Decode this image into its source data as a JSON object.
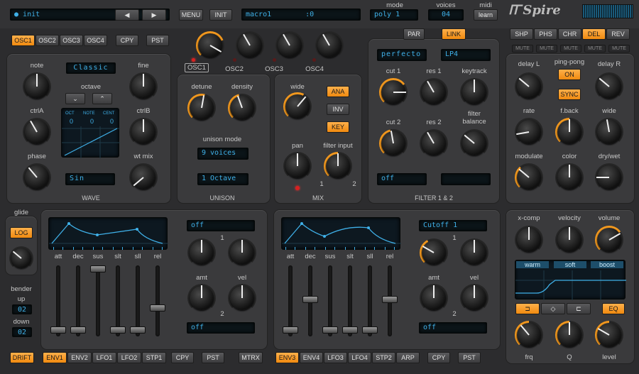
{
  "header": {
    "preset_name": "init",
    "menu": "MENU",
    "init": "INIT",
    "macro": "macro1",
    "macro_val": ":0",
    "mode_label": "mode",
    "mode_val": "poly 1",
    "voices_label": "voices",
    "voices_val": "04",
    "midi_label": "midi",
    "learn": "learn",
    "logo": "Spire"
  },
  "osc_tabs": [
    "OSC1",
    "OSC2",
    "OSC3",
    "OSC4"
  ],
  "cpy": "CPY",
  "pst": "PST",
  "osc_knobs": [
    "OSC1",
    "OSC2",
    "OSC3",
    "OSC4"
  ],
  "osc": {
    "note": "note",
    "fine": "fine",
    "mode": "Classic",
    "octave": "octave",
    "ctrlA": "ctrlA",
    "ctrlB": "ctrlB",
    "phase": "phase",
    "wtmix": "wt mix",
    "wave": "Sin",
    "section": "WAVE",
    "oct": "OCT",
    "note_h": "NOTE",
    "cent": "CENT",
    "oct_v": "0",
    "note_v": "0",
    "cent_v": "0"
  },
  "unison": {
    "detune": "detune",
    "density": "density",
    "mode": "unison mode",
    "voices": "9 voices",
    "octave": "1 Octave",
    "section": "UNISON"
  },
  "mix": {
    "wide": "wide",
    "ana": "ANA",
    "inv": "INV",
    "key": "KEY",
    "pan": "pan",
    "filter_input": "filter input",
    "one": "1",
    "two": "2",
    "section": "MIX"
  },
  "filter": {
    "par": "PAR",
    "link": "LINK",
    "type1": "perfecto",
    "type2": "LP4",
    "cut1": "cut 1",
    "res1": "res 1",
    "keytrack": "keytrack",
    "cut2": "cut 2",
    "res2": "res 2",
    "balance": "filter balance",
    "mode1": "off",
    "section": "FILTER 1 & 2"
  },
  "fx_tabs": [
    "SHP",
    "PHS",
    "CHR",
    "DEL",
    "REV"
  ],
  "mute": "MUTE",
  "delay": {
    "delayL": "delay L",
    "pingpong": "ping-pong",
    "on": "ON",
    "delayR": "delay R",
    "sync": "SYNC",
    "rate": "rate",
    "fback": "f.back",
    "wide": "wide",
    "modulate": "modulate",
    "color": "color",
    "drywet": "dry/wet"
  },
  "glide": {
    "label": "glide",
    "log": "LOG",
    "bender": "bender",
    "up": "up",
    "up_v": "02",
    "down": "down",
    "down_v": "02",
    "drift": "DRIFT"
  },
  "env_left": {
    "labels": [
      "att",
      "dec",
      "sus",
      "slt",
      "sll",
      "rel"
    ],
    "dest": "off",
    "dest2": "off",
    "amt": "amt",
    "vel": "vel",
    "one": "1",
    "two": "2",
    "tabs": [
      "ENV1",
      "ENV2",
      "LFO1",
      "LFO2",
      "STP1"
    ],
    "cpy": "CPY",
    "pst": "PST",
    "mtrx": "MTRX"
  },
  "env_right": {
    "labels": [
      "att",
      "dec",
      "sus",
      "slt",
      "sll",
      "rel"
    ],
    "dest": "Cutoff 1",
    "dest2": "off",
    "amt": "amt",
    "vel": "vel",
    "one": "1",
    "two": "2",
    "tabs": [
      "ENV3",
      "ENV4",
      "LFO3",
      "LFO4",
      "STP2",
      "ARP"
    ],
    "cpy": "CPY",
    "pst": "PST"
  },
  "eq": {
    "xcomp": "x-comp",
    "velocity": "velocity",
    "volume": "volume",
    "warm": "warm",
    "soft": "soft",
    "boost": "boost",
    "eq": "EQ",
    "frq": "frq",
    "q": "Q",
    "level": "level"
  },
  "colors": {
    "accent": "#f59a1e",
    "lcd": "#3fb0e8",
    "panel": "#3a3a3c"
  }
}
